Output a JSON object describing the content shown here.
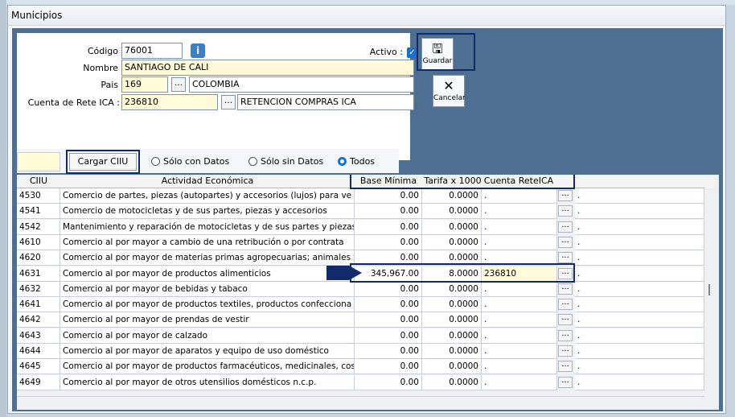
{
  "window": {
    "title": "Municipios"
  },
  "form": {
    "codigo_label": "Código",
    "codigo_value": "76001",
    "nombre_label": "Nombre",
    "nombre_value": "SANTIAGO DE CALI",
    "pais_label": "Pais",
    "pais_code": "169",
    "pais_name": "COLOMBIA",
    "cuenta_label": "Cuenta de Rete ICA :",
    "cuenta_code": "236810",
    "cuenta_name": "RETENCION COMPRAS ICA",
    "activo_label": "Activo :",
    "activo_checked": true
  },
  "toolbar": {
    "guardar_label": "Guardar",
    "cancelar_label": "Cancelar"
  },
  "filter": {
    "cargar_label": "Cargar CIIU",
    "radio_con_datos": "Sólo con Datos",
    "radio_sin_datos": "Sólo sin Datos",
    "radio_todos": "Todos",
    "selected": "Todos"
  },
  "grid": {
    "columns": [
      "CIIU",
      "Actividad Económica",
      "Base Mínima",
      "Tarifa x 1000",
      "Cuenta ReteICA"
    ],
    "rows": [
      {
        "ciiu": "4530",
        "actividad": "Comercio de partes, piezas (autopartes) y accesorios (lujos) para ve",
        "base": "0.00",
        "tarifa": "0.0000",
        "cuenta": ".",
        "extra": "."
      },
      {
        "ciiu": "4541",
        "actividad": "Comercio de motocicletas y de sus partes, piezas y accesorios",
        "base": "0.00",
        "tarifa": "0.0000",
        "cuenta": ".",
        "extra": "."
      },
      {
        "ciiu": "4542",
        "actividad": "Mantenimiento y reparación de motocicletas y de sus partes y piezas",
        "base": "0.00",
        "tarifa": "0.0000",
        "cuenta": ".",
        "extra": "."
      },
      {
        "ciiu": "4610",
        "actividad": "Comercio al por mayor a cambio de una retribución o por contrata",
        "base": "0.00",
        "tarifa": "0.0000",
        "cuenta": ".",
        "extra": "."
      },
      {
        "ciiu": "4620",
        "actividad": "Comercio al por mayor de materias primas agropecuarias; animales v",
        "base": "0.00",
        "tarifa": "0.0000",
        "cuenta": ".",
        "extra": "."
      },
      {
        "ciiu": "4631",
        "actividad": "Comercio al por mayor de productos alimenticios",
        "base": "345,967.00",
        "tarifa": "8.0000",
        "cuenta": "236810",
        "extra": ".",
        "selected": true
      },
      {
        "ciiu": "4632",
        "actividad": "Comercio al por mayor de bebidas y tabaco",
        "base": "0.00",
        "tarifa": "0.0000",
        "cuenta": ".",
        "extra": "."
      },
      {
        "ciiu": "4641",
        "actividad": "Comercio al por mayor de productos textiles, productos confecciona",
        "base": "0.00",
        "tarifa": "0.0000",
        "cuenta": ".",
        "extra": "."
      },
      {
        "ciiu": "4642",
        "actividad": "Comercio al por mayor de prendas de vestir",
        "base": "0.00",
        "tarifa": "0.0000",
        "cuenta": ".",
        "extra": "."
      },
      {
        "ciiu": "4643",
        "actividad": "Comercio al por mayor de calzado",
        "base": "0.00",
        "tarifa": "0.0000",
        "cuenta": ".",
        "extra": "."
      },
      {
        "ciiu": "4644",
        "actividad": "Comercio al por mayor de aparatos y equipo de uso doméstico",
        "base": "0.00",
        "tarifa": "0.0000",
        "cuenta": ".",
        "extra": "."
      },
      {
        "ciiu": "4645",
        "actividad": "Comercio al por mayor de productos farmacéuticos, medicinales, cos",
        "base": "0.00",
        "tarifa": "0.0000",
        "cuenta": ".",
        "extra": "."
      },
      {
        "ciiu": "4649",
        "actividad": "Comercio al por mayor de otros utensilios domésticos n.c.p.",
        "base": "0.00",
        "tarifa": "0.0000",
        "cuenta": ".",
        "extra": "."
      }
    ]
  },
  "icons": {
    "info": "info-icon",
    "save": "save-icon",
    "cancel": "cancel-icon",
    "dots": "ellipsis-icon"
  },
  "colors": {
    "panel": "#4e6f91",
    "highlight": "#102a6a",
    "yellow_field": "#fffbd8",
    "accent": "#1a6fd0"
  }
}
